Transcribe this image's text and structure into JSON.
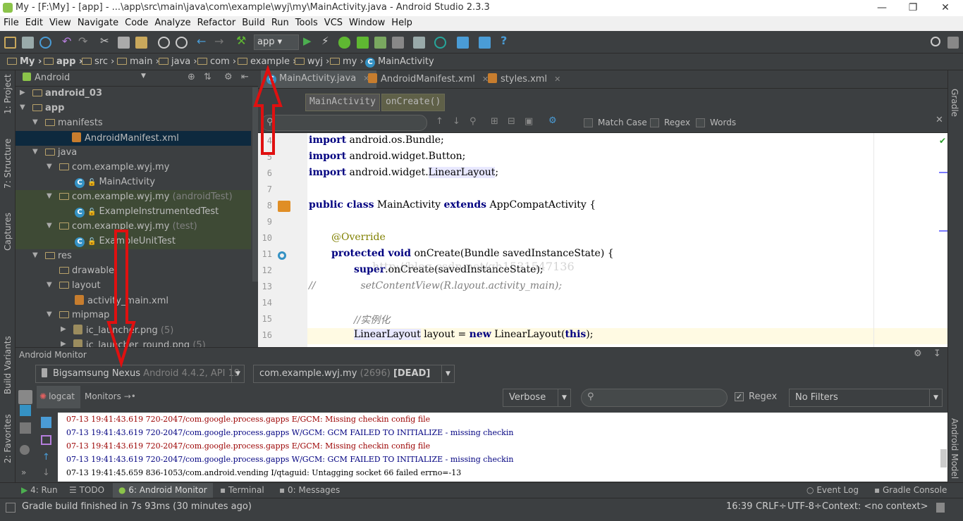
{
  "window": {
    "title": "My - [F:\\My] - [app] - ...\\app\\src\\main\\java\\com\\example\\wyj\\my\\MainActivity.java - Android Studio 2.3.3"
  },
  "menu": [
    "File",
    "Edit",
    "View",
    "Navigate",
    "Code",
    "Analyze",
    "Refactor",
    "Build",
    "Run",
    "Tools",
    "VCS",
    "Window",
    "Help"
  ],
  "toolbar": {
    "run_config": "app"
  },
  "breadcrumb": [
    "My",
    "app",
    "src",
    "main",
    "java",
    "com",
    "example",
    "wyj",
    "my",
    "MainActivity"
  ],
  "project_panel": {
    "view_selector": "Android",
    "tree": [
      {
        "label": "android_03",
        "suffix": ""
      },
      {
        "label": "app",
        "suffix": ""
      },
      {
        "label": "manifests",
        "suffix": ""
      },
      {
        "label": "AndroidManifest.xml",
        "suffix": ""
      },
      {
        "label": "java",
        "suffix": ""
      },
      {
        "label": "com.example.wyj.my",
        "suffix": ""
      },
      {
        "label": "MainActivity",
        "suffix": ""
      },
      {
        "label": "com.example.wyj.my",
        "suffix": "(androidTest)"
      },
      {
        "label": "ExampleInstrumentedTest",
        "suffix": ""
      },
      {
        "label": "com.example.wyj.my",
        "suffix": "(test)"
      },
      {
        "label": "ExampleUnitTest",
        "suffix": ""
      },
      {
        "label": "res",
        "suffix": ""
      },
      {
        "label": "drawable",
        "suffix": ""
      },
      {
        "label": "layout",
        "suffix": ""
      },
      {
        "label": "activity_main.xml",
        "suffix": ""
      },
      {
        "label": "mipmap",
        "suffix": ""
      },
      {
        "label": "ic_launcher.png",
        "suffix": "(5)"
      },
      {
        "label": "ic_launcher_round.png",
        "suffix": "(5)"
      }
    ]
  },
  "side_labels": {
    "left": [
      "1: Project",
      "7: Structure",
      "Captures",
      "Build Variants",
      "2: Favorites"
    ],
    "right": [
      "Gradle",
      "Android Model"
    ]
  },
  "editor": {
    "tabs": [
      "MainActivity.java",
      "AndroidManifest.xml",
      "styles.xml"
    ],
    "crumbs": [
      "MainActivity",
      "onCreate()"
    ],
    "search": {
      "match_case": "Match Case",
      "regex": "Regex",
      "words": "Words"
    },
    "line_numbers": [
      "4",
      "5",
      "6",
      "7",
      "8",
      "9",
      "10",
      "11",
      "12",
      "13",
      "14",
      "15",
      "16"
    ],
    "lines": {
      "l4a": "import",
      "l4b": " android.os.Bundle;",
      "l5a": "import",
      "l5b": " android.widget.Button;",
      "l6a": "import",
      "l6b": " android.widget.",
      "l6c": "LinearLayout",
      "l6d": ";",
      "l8a": "public class",
      "l8b": " MainActivity ",
      "l8c": "extends",
      "l8d": " AppCompatActivity {",
      "l10": "@Override",
      "l11a": "protected void",
      "l11b": " onCreate(Bundle savedInstanceState) {",
      "l12a": "super",
      "l12b": ".onCreate(savedInstanceState);",
      "l13a": "//",
      "l13b": "setContentView(R.layout.activity_main);",
      "l15": "//实例化",
      "l16a": "LinearLayout",
      "l16b": " layout = ",
      "l16c": "new",
      "l16d": " LinearLayout(",
      "l16e": "this",
      "l16f": ");"
    },
    "watermark": "http://blog.csdn.net/qh1531547136"
  },
  "monitor": {
    "title": "Android Monitor",
    "device": {
      "name": "Bigsamsung Nexus",
      "detail": "Android 4.4.2, API 19"
    },
    "process": {
      "name": "com.example.wyj.my",
      "detail": "(2696)",
      "state": "[DEAD]"
    },
    "tabs": [
      "logcat",
      "Monitors"
    ],
    "level": "Verbose",
    "regex_label": "Regex",
    "filter": "No Filters",
    "log": [
      {
        "text": "07-13 19:41:43.619 720-2047/com.google.process.gapps E/GCM: Missing checkin config file",
        "color": "#9b0000"
      },
      {
        "text": "07-13 19:41:43.619 720-2047/com.google.process.gapps W/GCM: GCM FAILED TO INITIALIZE - missing checkin",
        "color": "#000080"
      },
      {
        "text": "07-13 19:41:43.619 720-2047/com.google.process.gapps E/GCM: Missing checkin config file",
        "color": "#9b0000"
      },
      {
        "text": "07-13 19:41:43.619 720-2047/com.google.process.gapps W/GCM: GCM FAILED TO INITIALIZE - missing checkin",
        "color": "#000080"
      },
      {
        "text": "07-13 19:41:45.659 836-1053/com.android.vending I/qtaguid: Untagging socket 66 failed errno=-13",
        "color": "#000000"
      }
    ]
  },
  "bottom_tabs": [
    "4: Run",
    "TODO",
    "6: Android Monitor",
    "Terminal",
    "0: Messages"
  ],
  "bottom_right_tabs": [
    "Event Log",
    "Gradle Console"
  ],
  "status": {
    "message": "Gradle build finished in 7s 93ms (30 minutes ago)",
    "position": "16:39",
    "line_sep": "CRLF÷",
    "encoding": "UTF-8÷",
    "context": "Context: <no context>"
  }
}
